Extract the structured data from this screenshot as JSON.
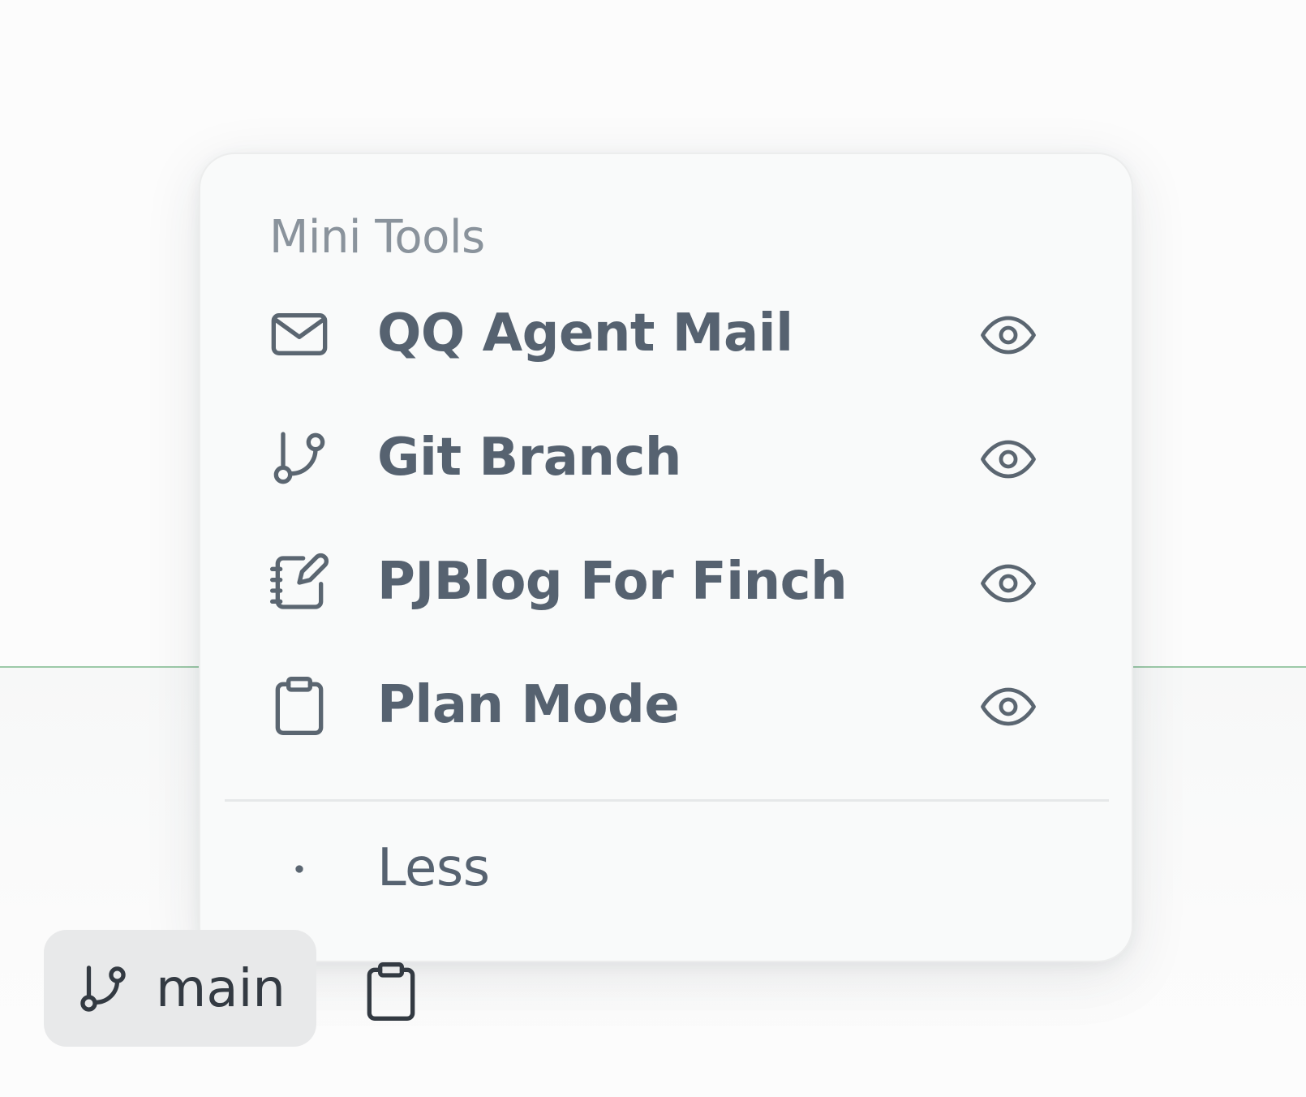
{
  "colors": {
    "accent": "#9cc9a8",
    "text": "#566270",
    "muted": "#8a939c"
  },
  "popup": {
    "section_title": "Mini Tools",
    "items": [
      {
        "label": "QQ Agent Mail",
        "icon": "mail-icon",
        "visibility_icon": "eye-icon"
      },
      {
        "label": "Git Branch",
        "icon": "git-branch-icon",
        "visibility_icon": "eye-icon"
      },
      {
        "label": "PJBlog For Finch",
        "icon": "notebook-pen-icon",
        "visibility_icon": "eye-icon"
      },
      {
        "label": "Plan Mode",
        "icon": "clipboard-icon",
        "visibility_icon": "eye-icon"
      }
    ],
    "less": {
      "label": "Less",
      "icon": "dot-icon"
    }
  },
  "toolbar": {
    "branch": {
      "label": "main",
      "icon": "git-branch-icon"
    },
    "plan_button": {
      "icon": "clipboard-icon"
    }
  }
}
